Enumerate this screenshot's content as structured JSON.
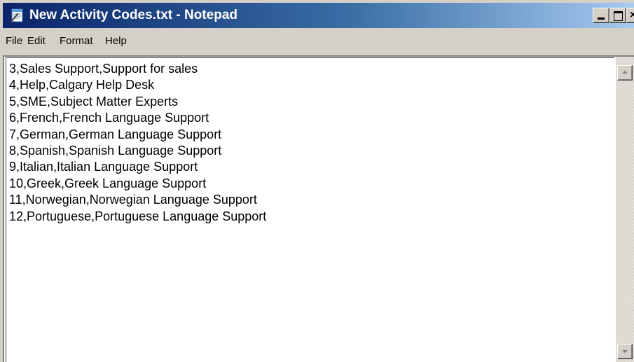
{
  "window": {
    "title": "New Activity Codes.txt - Notepad",
    "icon": "notepad-icon"
  },
  "title_buttons": {
    "minimize_icon": "minimize-icon",
    "maximize_icon": "maximize-icon",
    "close_icon": "close-icon",
    "close_glyph": "×"
  },
  "menu": {
    "items": [
      {
        "label": "File"
      },
      {
        "label": "Edit"
      },
      {
        "label": "Format"
      },
      {
        "label": "Help"
      }
    ]
  },
  "editor": {
    "lines": [
      "3,Sales Support,Support for sales",
      "4,Help,Calgary Help Desk",
      "5,SME,Subject Matter Experts",
      "6,French,French Language Support",
      "7,German,German Language Support",
      "8,Spanish,Spanish Language Support",
      "9,Italian,Italian Language Support",
      "10,Greek,Greek Language Support",
      "11,Norwegian,Norwegian Language Support",
      "12,Portuguese,Portuguese Language Support"
    ]
  },
  "scrollbar": {
    "up_icon": "scroll-up-arrow-icon",
    "down_icon": "scroll-down-arrow-icon"
  },
  "colors": {
    "titlebar_start": "#0a246a",
    "titlebar_end": "#a6caf0",
    "chrome": "#d4d0c8",
    "editor_bg": "#ffffff"
  }
}
